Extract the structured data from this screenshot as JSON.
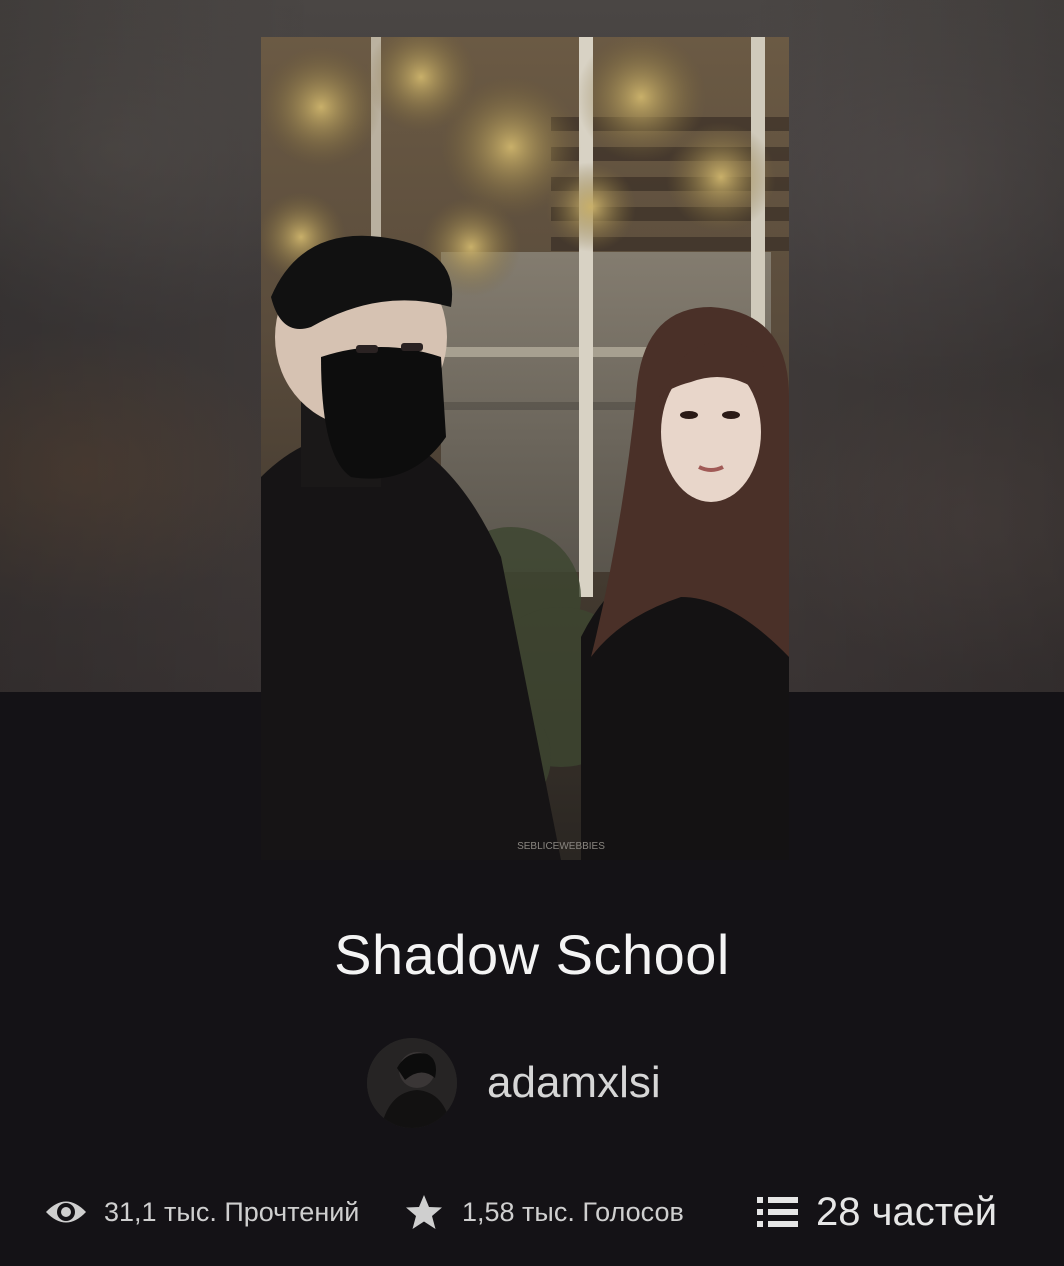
{
  "story": {
    "title": "Shadow School",
    "cover_watermark": "SEBLICEWEBBIES"
  },
  "author": {
    "username": "adamxlsi"
  },
  "stats": {
    "reads_label": "31,1 тыс. Прочтений",
    "votes_label": "1,58 тыс. Голосов",
    "parts_label": "28 частей"
  },
  "icons": {
    "reads": "eye-icon",
    "votes": "star-icon",
    "parts": "list-icon"
  },
  "colors": {
    "background": "#141216",
    "title_text": "#f4f4f4",
    "secondary_text": "#cfcfcf"
  }
}
